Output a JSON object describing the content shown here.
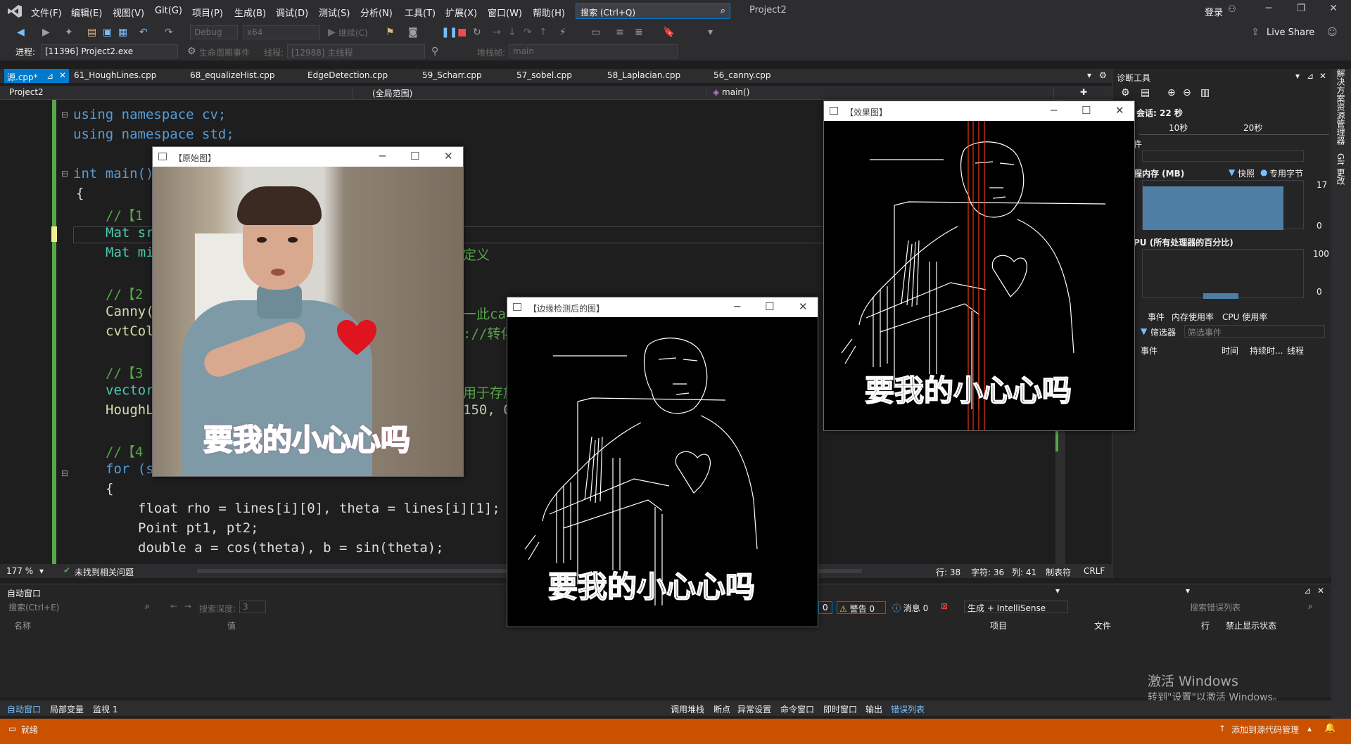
{
  "menubar": {
    "items": [
      "文件(F)",
      "编辑(E)",
      "视图(V)",
      "Git(G)",
      "项目(P)",
      "生成(B)",
      "调试(D)",
      "测试(S)",
      "分析(N)",
      "工具(T)",
      "扩展(X)",
      "窗口(W)",
      "帮助(H)"
    ],
    "search_placeholder": "搜索 (Ctrl+Q)",
    "project_name": "Project2",
    "login": "登录"
  },
  "toolbar": {
    "config": "Debug",
    "platform": "x64",
    "continue": "继续(C)",
    "process_label": "进程:",
    "process_value": "[11396] Project2.exe",
    "lifecycle": "生命周期事件",
    "thread_label": "线程:",
    "thread_value": "[12988] 主线程",
    "stackframe_label": "堆栈帧:",
    "stackframe_value": "main",
    "live_share": "Live Share"
  },
  "tabs": {
    "active": "源.cpp*",
    "others": [
      "61_HoughLines.cpp",
      "68_equalizeHist.cpp",
      "EdgeDetection.cpp",
      "59_Scharr.cpp",
      "57_sobel.cpp",
      "58_Laplacian.cpp",
      "56_canny.cpp"
    ]
  },
  "navbar": {
    "project": "Project2",
    "scope": "(全局范围)",
    "member": "main()"
  },
  "code": {
    "l1": "using namespace cv;",
    "l2": "using namespace std;",
    "l3": "int main()",
    "l4": "{",
    "l5": "//【1",
    "l6": "Mat sr",
    "l7": "Mat mi",
    "l7b": "定义",
    "l8": "//【2",
    "l9": "Canny(",
    "l9b": "一此ca",
    "l10": "cvtCol",
    "l10b": "://转化",
    "l11": "//【3",
    "l11b": "用于存放",
    "l12": "vector",
    "l13": "HoughL",
    "l13b": "150, 0",
    "l14": "//【4",
    "l15": "for (s",
    "l16": "{",
    "l17": "float rho = lines[i][0], theta = lines[i][1];",
    "l18": "Point pt1, pt2;",
    "l19": "double a = cos(theta), b = sin(theta);"
  },
  "editor_status": {
    "zoom": "177 %",
    "issues": "未找到相关问题",
    "line": "行: 38",
    "char": "字符: 36",
    "col": "列: 41",
    "tab": "制表符",
    "eol": "CRLF"
  },
  "diag": {
    "title": "诊断工具",
    "session": "会话: 22 秒",
    "t1": "10秒",
    "t2": "20秒",
    "events": "件",
    "memory": "程内存 (MB)",
    "snapshot": "快照",
    "private_bytes": "专用字节",
    "mem_max": "17",
    "mem_min": "0",
    "cpu": "PU (所有处理器的百分比)",
    "cpu_max": "100",
    "cpu_min": "0",
    "tabs": [
      "事件",
      "内存使用率",
      "CPU 使用率"
    ],
    "filter": "筛选器",
    "filter_events": "筛选事件",
    "cols": [
      "事件",
      "时间",
      "持续时...",
      "线程"
    ]
  },
  "auto": {
    "title": "自动窗口",
    "search": "搜索(Ctrl+E)",
    "depth_label": "搜索深度:",
    "depth_value": "3",
    "col_name": "名称",
    "col_value": "值"
  },
  "errors": {
    "errors_count": "0",
    "warnings": "警告 0",
    "messages": "消息 0",
    "build_filter": "生成 + IntelliSense",
    "search": "搜索错误列表",
    "cols": [
      "项目",
      "文件",
      "行",
      "禁止显示状态"
    ]
  },
  "bottom_tabs_left": [
    "自动窗口",
    "局部变量",
    "监视 1"
  ],
  "bottom_tabs_right": [
    "调用堆栈",
    "断点",
    "异常设置",
    "命令窗口",
    "即时窗口",
    "输出",
    "错误列表"
  ],
  "status": {
    "ready": "就绪",
    "source_control": "添加到源代码管理"
  },
  "activation": {
    "line1": "激活 Windows",
    "line2": "转到\"设置\"以激活 Windows。"
  },
  "right_rail": [
    "解决方案资源管理器",
    "Git 更改"
  ],
  "windows": {
    "original": {
      "title": "【原始图】",
      "caption": "要我的小心心吗"
    },
    "edges": {
      "title": "【边缘检测后的图】",
      "caption": "要我的小心心吗"
    },
    "effect": {
      "title": "【效果图】",
      "caption": "要我的小心心吗"
    }
  },
  "colors": {
    "accent": "#007acc",
    "status_bar": "#ca5100",
    "keyword": "#569cd6",
    "comment": "#57a64a",
    "type": "#4ec9b0"
  }
}
